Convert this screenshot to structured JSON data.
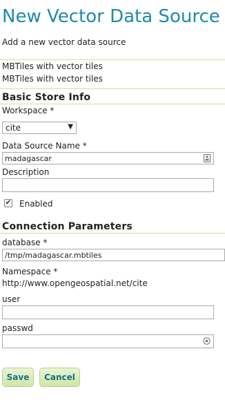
{
  "page": {
    "title": "New Vector Data Source",
    "subtitle": "Add a new vector data source",
    "type_line_1": "MBTiles with vector tiles",
    "type_line_2": "MBTiles with vector tiles"
  },
  "basic_store": {
    "heading": "Basic Store Info",
    "workspace_label": "Workspace *",
    "workspace_value": "cite",
    "datasource_name_label": "Data Source Name *",
    "datasource_name_value": "madagascar",
    "description_label": "Description",
    "description_value": "",
    "enabled_label": "Enabled",
    "enabled_checked": true
  },
  "connection": {
    "heading": "Connection Parameters",
    "database_label": "database *",
    "database_value": "/tmp/madagascar.mbtiles",
    "namespace_label": "Namespace *",
    "namespace_value": "http://www.opengeospatial.net/cite",
    "user_label": "user",
    "user_value": "",
    "passwd_label": "passwd",
    "passwd_value": ""
  },
  "buttons": {
    "save": "Save",
    "cancel": "Cancel"
  },
  "colors": {
    "title": "#1f8aa8",
    "divider": "#d4dba8",
    "button_bg": "#cfe6a6",
    "button_text": "#1a6f8a"
  },
  "icons": {
    "name_field_icon": "id-card-icon",
    "passwd_field_icon": "key-icon",
    "select_arrow": "chevron-down-icon"
  }
}
